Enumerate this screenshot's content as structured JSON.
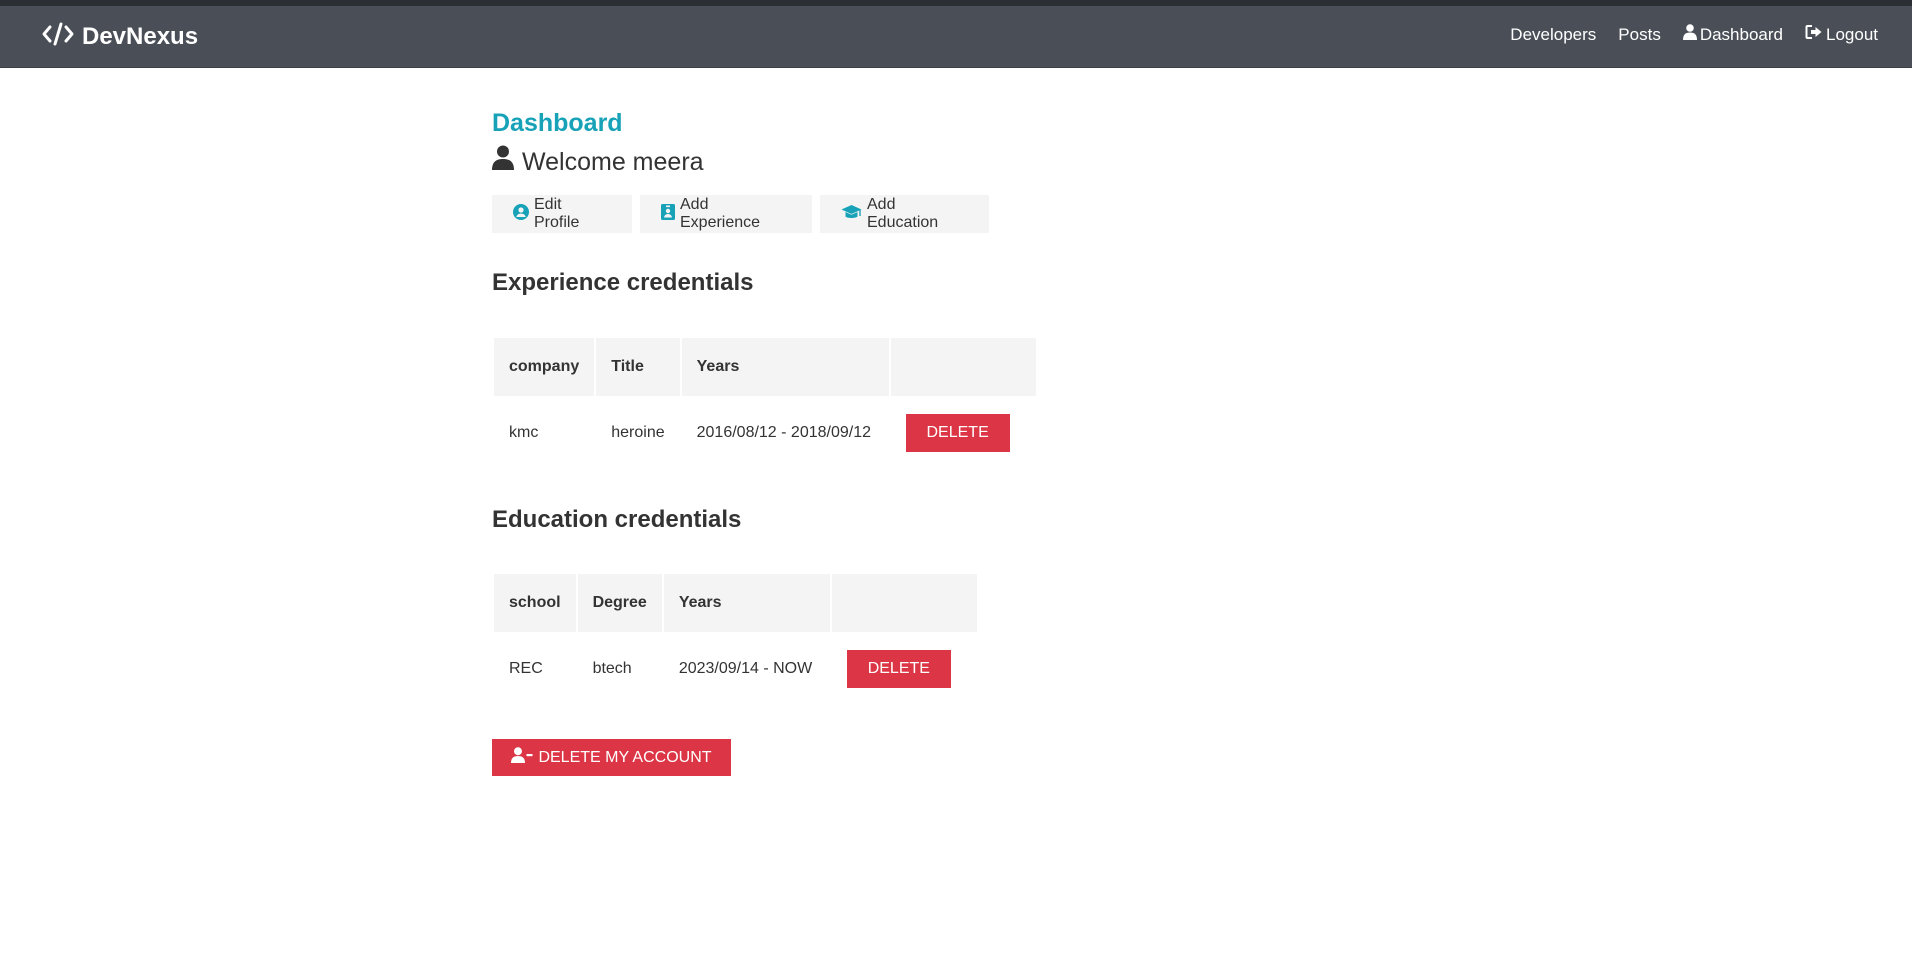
{
  "navbar": {
    "brand": "DevNexus",
    "links": [
      "Developers",
      "Posts",
      "Dashboard",
      "Logout"
    ]
  },
  "dashboard": {
    "title": "Dashboard",
    "welcome": "Welcome meera",
    "actions": {
      "edit_profile": "Edit Profile",
      "add_experience": "Add Experience",
      "add_education": "Add Education"
    }
  },
  "experience": {
    "title": "Experience credentials",
    "headers": [
      "company",
      "Title",
      "Years",
      ""
    ],
    "rows": [
      {
        "company": "kmc",
        "title": "heroine",
        "years": "2016/08/12 - 2018/09/12",
        "action": "DELETE"
      }
    ]
  },
  "education": {
    "title": "Education credentials",
    "headers": [
      "school",
      "Degree",
      "Years",
      ""
    ],
    "rows": [
      {
        "school": "REC",
        "degree": "btech",
        "years": "2023/09/14 - NOW",
        "action": "DELETE"
      }
    ]
  },
  "delete_account": "DELETE MY ACCOUNT",
  "colors": {
    "navbar": "#4a4f57",
    "accent": "#17a2b8",
    "danger": "#dc3545",
    "light": "#f4f4f4"
  },
  "icons": {
    "brand": "code-icon",
    "dashboard": "user-icon",
    "logout": "sign-out-icon",
    "welcome": "user-icon",
    "edit_profile": "user-circle-icon",
    "add_experience": "id-badge-icon",
    "add_education": "graduation-cap-icon",
    "delete_account": "user-minus-icon"
  }
}
